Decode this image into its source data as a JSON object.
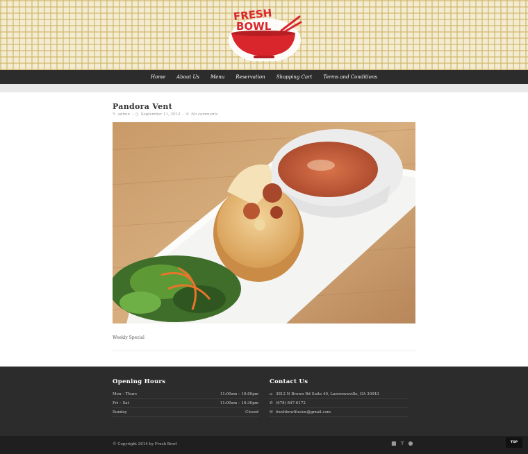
{
  "brand": {
    "logo_line1": "FRESH",
    "logo_line2": "BOWL"
  },
  "nav": {
    "items": [
      {
        "label": "Home"
      },
      {
        "label": "About Us"
      },
      {
        "label": "Menu"
      },
      {
        "label": "Reservation"
      },
      {
        "label": "Shopping Cart"
      },
      {
        "label": "Terms and Conditions"
      }
    ]
  },
  "post": {
    "title": "Pandora Vent",
    "author": "admin",
    "date": "September 11, 2014",
    "comments": "No comments",
    "body": "Weekly Special"
  },
  "footer": {
    "hours": {
      "heading": "Opening Hours",
      "rows": [
        {
          "days": "Mon – Thurs",
          "time": "11:00am – 10:00pm"
        },
        {
          "days": "Fri – Sat",
          "time": "11:00am – 10:30pm"
        },
        {
          "days": "Sunday",
          "time": "Closed"
        }
      ]
    },
    "contact": {
      "heading": "Contact Us",
      "address": "3812 N Brown Rd Suite 40, Lawrenceville, GA 30043",
      "phone": "(678) 847-6172",
      "email": "freshbowlfusion@gmail.com"
    },
    "copyright": "© Copyright 2014 by Fresh Bowl",
    "top_label": "TOP"
  },
  "colors": {
    "brand_red": "#d9262c",
    "header_bg": "#f3ecd3",
    "pattern": "#cdb25f",
    "dark": "#2c2c2c"
  }
}
